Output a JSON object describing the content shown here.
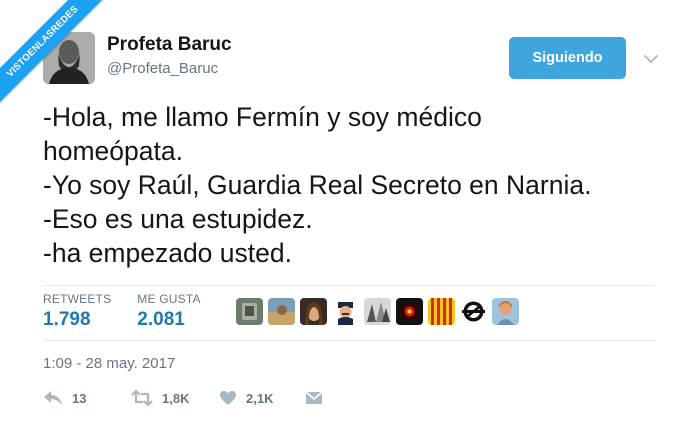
{
  "watermark": "VISTOENLASREDES",
  "user": {
    "name": "Profeta Baruc",
    "handle": "@Profeta_Baruc",
    "follow_label": "Siguiendo"
  },
  "tweet": {
    "lines": [
      "-Hola, me llamo Fermín y soy médico",
      "homeópata.",
      "-Yo soy Raúl, Guardia Real Secreto en Narnia.",
      "-Eso es una estupidez.",
      "-ha empezado usted."
    ]
  },
  "stats": {
    "retweets_label": "RETWEETS",
    "retweets_value": "1.798",
    "likes_label": "ME GUSTA",
    "likes_value": "2.081"
  },
  "timestamp": "1:09 - 28 may. 2017",
  "actions": {
    "reply_count": "13",
    "retweet_count": "1,8K",
    "like_count": "2,1K"
  },
  "colors": {
    "accent": "#1da1f2",
    "button": "#3ea6dd",
    "stat_value": "#1f7ab4",
    "secondary_text": "#657786"
  }
}
